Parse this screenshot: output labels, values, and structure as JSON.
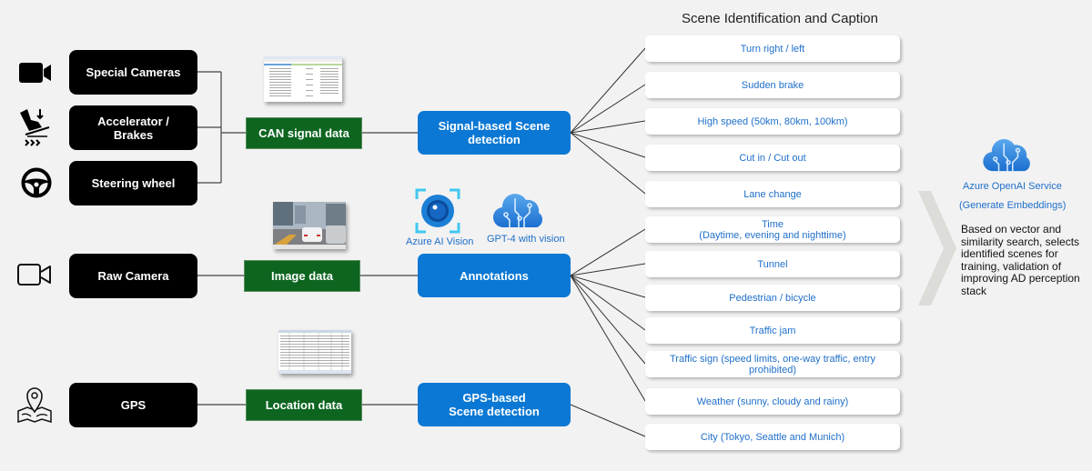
{
  "diagram": {
    "heading": "Scene Identification and Caption",
    "sources": [
      {
        "label": "Special Cameras",
        "icon": "video-camera-icon"
      },
      {
        "label": "Accelerator / Brakes",
        "icon": "pedal-icon"
      },
      {
        "label": "Steering wheel",
        "icon": "steering-wheel-icon"
      },
      {
        "label": "Raw Camera",
        "icon": "video-camera-outline-icon"
      },
      {
        "label": "GPS",
        "icon": "map-pin-icon"
      }
    ],
    "data_nodes": [
      {
        "label": "CAN signal data",
        "thumbnail": "spreadsheet-thumbnail"
      },
      {
        "label": "Image data",
        "thumbnail": "road-photo-thumbnail"
      },
      {
        "label": "Location data",
        "thumbnail": "table-thumbnail"
      }
    ],
    "detection_nodes": [
      {
        "label": "Signal-based Scene detection"
      },
      {
        "label": "Annotations"
      },
      {
        "label": "GPS-based Scene detection"
      }
    ],
    "services": [
      {
        "label": "Azure AI Vision",
        "icon": "eye-lens-icon"
      },
      {
        "label": "GPT-4 with vision",
        "icon": "cloud-circuit-icon"
      }
    ],
    "scenes": [
      "Turn right / left",
      "Sudden brake",
      "High speed (50km, 80km, 100km)",
      "Cut in / Cut out",
      "Lane change",
      "Time\n(Daytime, evening and nighttime)",
      "Tunnel",
      "Pedestrian / bicycle",
      "Traffic jam",
      "Traffic sign (speed limits, one-way traffic, entry prohibited)",
      "Weather (sunny, cloudy and rainy)",
      "City (Tokyo, Seattle and Munich)"
    ],
    "output": {
      "service_name": "Azure OpenAI Service",
      "service_sub": "(Generate Embeddings)",
      "description": "Based on vector and similarity search, selects identified scenes for training, validation of improving AD perception stack"
    }
  },
  "colors": {
    "source_fill": "#000000",
    "data_fill": "#0d6520",
    "detection_fill": "#0a78d4",
    "scene_text": "#1f6fc9",
    "background": "#f2f2f2"
  }
}
